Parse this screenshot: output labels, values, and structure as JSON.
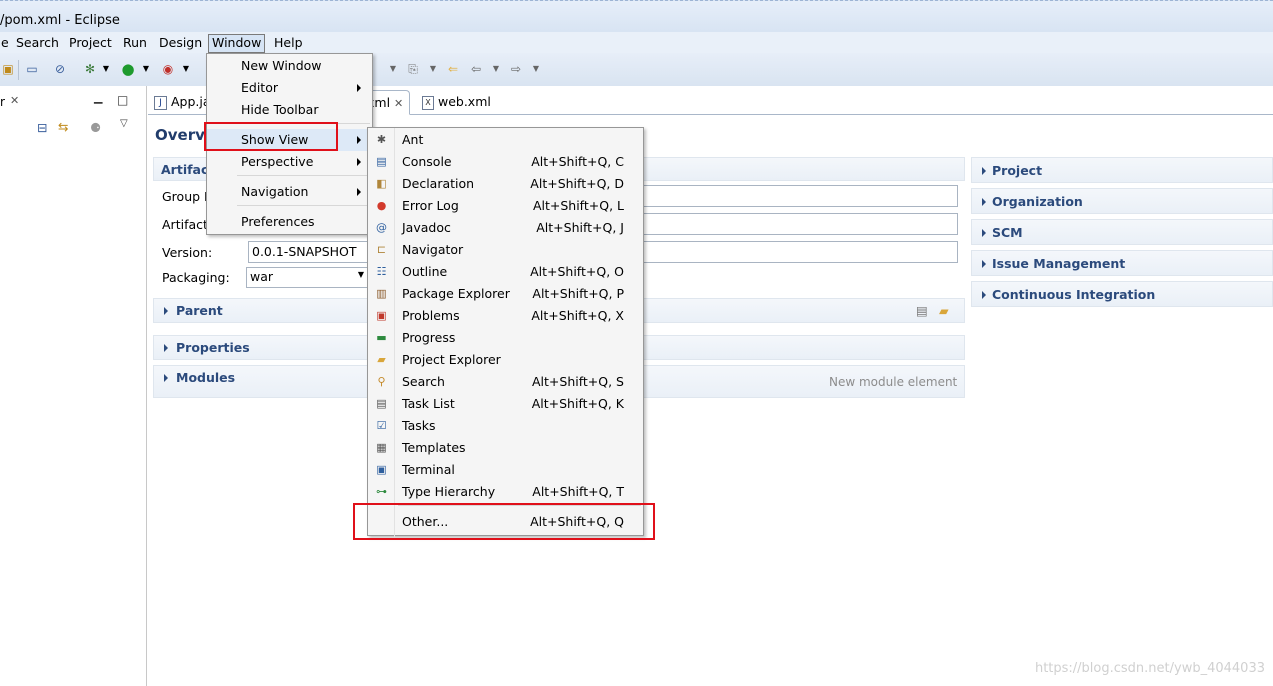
{
  "window": {
    "title": "/pom.xml - Eclipse"
  },
  "menubar": {
    "items": [
      "e",
      "Search",
      "Project",
      "Run",
      "Design",
      "Window",
      "Help"
    ],
    "active": "Window"
  },
  "tabs": [
    {
      "label": "App.ja",
      "icon": "java-file-icon"
    },
    {
      "label": "xml",
      "icon": "close-icon"
    },
    {
      "label": "web.xml",
      "icon": "xml-file-icon"
    }
  ],
  "editor": {
    "title": "Overvi",
    "artifact_section": "Artifact",
    "fields": [
      {
        "label": "Group I",
        "value": ""
      },
      {
        "label": "Artifact",
        "value": ""
      },
      {
        "label": "Version:",
        "value": "0.0.1-SNAPSHOT"
      },
      {
        "label": "Packaging:",
        "value": "war"
      }
    ],
    "sections": [
      "Parent",
      "Properties",
      "Modules"
    ],
    "modules_hint": "New module element"
  },
  "right_sections": [
    "Project",
    "Organization",
    "SCM",
    "Issue Management",
    "Continuous Integration"
  ],
  "window_menu": {
    "items": [
      {
        "label": "New Window",
        "submenu": false
      },
      {
        "label": "Editor",
        "submenu": true
      },
      {
        "label": "Hide Toolbar",
        "submenu": false
      },
      {
        "label": "Show View",
        "submenu": true
      },
      {
        "label": "Perspective",
        "submenu": true
      },
      {
        "label": "Navigation",
        "submenu": true
      },
      {
        "label": "Preferences",
        "submenu": false
      }
    ]
  },
  "show_view_menu": {
    "items": [
      {
        "label": "Ant",
        "shortcut": "",
        "icon": "ant-icon"
      },
      {
        "label": "Console",
        "shortcut": "Alt+Shift+Q, C",
        "icon": "console-icon"
      },
      {
        "label": "Declaration",
        "shortcut": "Alt+Shift+Q, D",
        "icon": "declaration-icon"
      },
      {
        "label": "Error Log",
        "shortcut": "Alt+Shift+Q, L",
        "icon": "error-log-icon"
      },
      {
        "label": "Javadoc",
        "shortcut": "Alt+Shift+Q, J",
        "icon": "javadoc-icon"
      },
      {
        "label": "Navigator",
        "shortcut": "",
        "icon": "navigator-icon"
      },
      {
        "label": "Outline",
        "shortcut": "Alt+Shift+Q, O",
        "icon": "outline-icon"
      },
      {
        "label": "Package Explorer",
        "shortcut": "Alt+Shift+Q, P",
        "icon": "package-explorer-icon"
      },
      {
        "label": "Problems",
        "shortcut": "Alt+Shift+Q, X",
        "icon": "problems-icon"
      },
      {
        "label": "Progress",
        "shortcut": "",
        "icon": "progress-icon"
      },
      {
        "label": "Project Explorer",
        "shortcut": "",
        "icon": "project-explorer-icon"
      },
      {
        "label": "Search",
        "shortcut": "Alt+Shift+Q, S",
        "icon": "search-icon"
      },
      {
        "label": "Task List",
        "shortcut": "Alt+Shift+Q, K",
        "icon": "task-list-icon"
      },
      {
        "label": "Tasks",
        "shortcut": "",
        "icon": "tasks-icon"
      },
      {
        "label": "Templates",
        "shortcut": "",
        "icon": "templates-icon"
      },
      {
        "label": "Terminal",
        "shortcut": "",
        "icon": "terminal-icon"
      },
      {
        "label": "Type Hierarchy",
        "shortcut": "Alt+Shift+Q, T",
        "icon": "type-hierarchy-icon"
      }
    ],
    "other": {
      "label": "Other...",
      "shortcut": "Alt+Shift+Q, Q"
    }
  },
  "watermark": "https://blog.csdn.net/ywb_4044033",
  "colors": {
    "highlight_box": "#e0101a",
    "section_title": "#2b4a7c"
  }
}
